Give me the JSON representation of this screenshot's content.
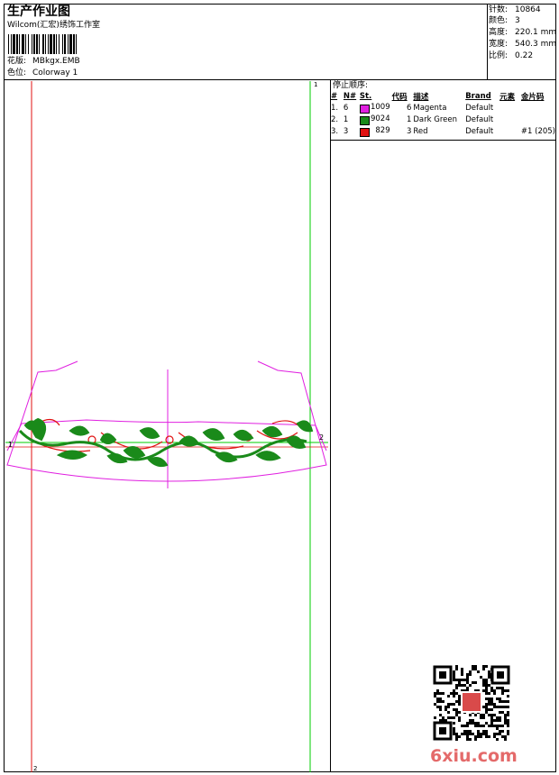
{
  "header": {
    "title": "生产作业图",
    "company": "Wilcom(汇宏)绣饰工作室",
    "design_label": "花版:",
    "design_value": "MBkgx.EMB",
    "colorway_label": "色位:",
    "colorway_value": "Colorway 1"
  },
  "stats": [
    {
      "label": "针数:",
      "value": "10864"
    },
    {
      "label": "颜色:",
      "value": "3"
    },
    {
      "label": "高度:",
      "value": "220.1 mm"
    },
    {
      "label": "宽度:",
      "value": "540.3 mm"
    },
    {
      "label": "比例:",
      "value": "0.22"
    }
  ],
  "stop_sequence": {
    "title": "停止顺序:",
    "columns": [
      "#",
      "N#",
      "St.",
      "代码",
      "描述",
      "Brand",
      "元素",
      "金片码"
    ],
    "rows": [
      {
        "num": "1.",
        "n": "6",
        "color": "#e020e0",
        "stitches": "1009",
        "code": "6",
        "desc": "Magenta",
        "brand": "Default",
        "element": "",
        "sequin": ""
      },
      {
        "num": "2.",
        "n": "1",
        "color": "#1a8a1a",
        "stitches": "9024",
        "code": "1",
        "desc": "Dark Green",
        "brand": "Default",
        "element": "",
        "sequin": ""
      },
      {
        "num": "3.",
        "n": "3",
        "color": "#e01010",
        "stitches": "829",
        "code": "3",
        "desc": "Red",
        "brand": "Default",
        "element": "",
        "sequin": "#1 (205)"
      }
    ]
  },
  "canvas": {
    "marker_left": "1",
    "marker_right": "2",
    "marker_top": "1",
    "marker_bottom": "2"
  },
  "watermark": "6xiu.com"
}
